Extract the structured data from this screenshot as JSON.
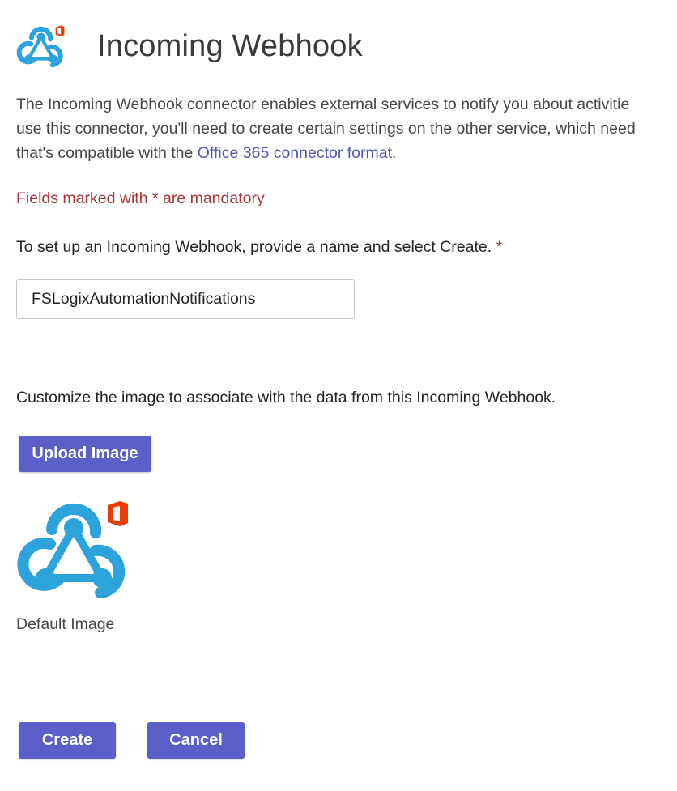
{
  "header": {
    "title": "Incoming Webhook",
    "logo_icon": "webhook-office-icon"
  },
  "intro": {
    "line1": "The Incoming Webhook connector enables external services to notify you about activitie",
    "line2": "use this connector, you'll need to create certain settings on the other service, which need",
    "line3_prefix": "that's compatible with the ",
    "line3_link": "Office 365 connector format",
    "line3_suffix": "."
  },
  "mandatory_note": "Fields marked with * are mandatory",
  "setup": {
    "label": "To set up an Incoming Webhook, provide a name and select Create. ",
    "required_marker": "*",
    "name_value": "FSLogixAutomationNotifications"
  },
  "image_section": {
    "label": "Customize the image to associate with the data from this Incoming Webhook.",
    "upload_label": "Upload Image",
    "default_caption": "Default Image",
    "default_icon": "webhook-office-icon"
  },
  "actions": {
    "create_label": "Create",
    "cancel_label": "Cancel"
  },
  "colors": {
    "accent": "#5b5fc7",
    "link": "#5558af",
    "required": "#a4373a",
    "webhook_blue": "#2ca3db",
    "office_red": "#eb3c00"
  }
}
